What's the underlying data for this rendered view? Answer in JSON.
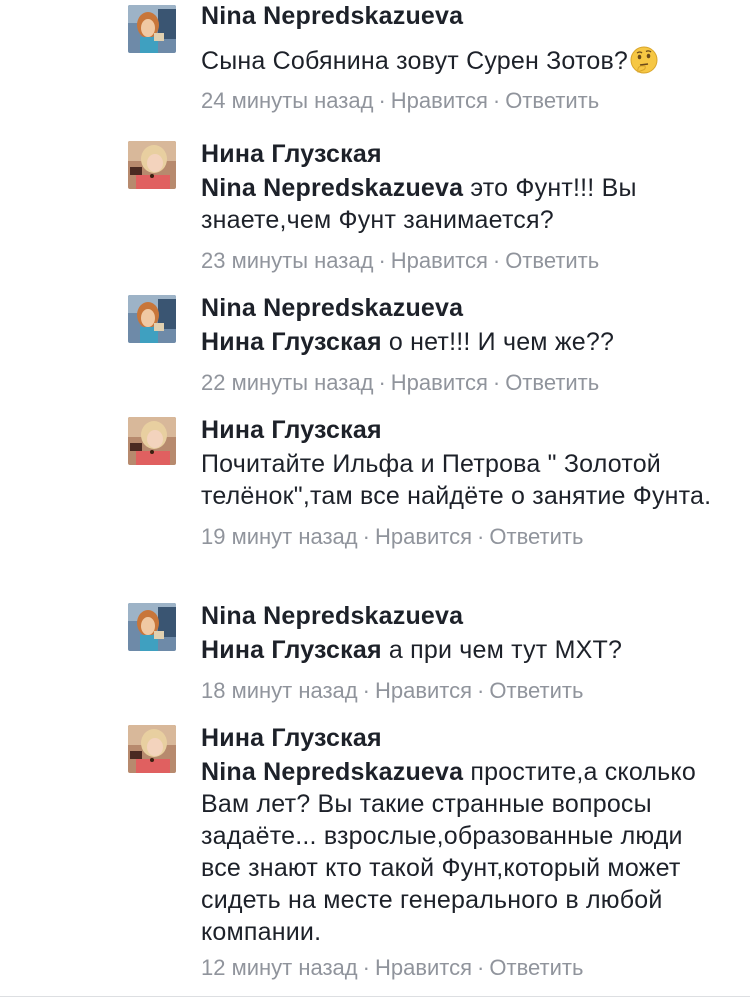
{
  "comments": [
    {
      "author": "Nina Nepredskazueva",
      "mention": "",
      "text": "Сына Собянина зовут Сурен Зотов?",
      "emoji": "thinking-face",
      "time": "24 минуты назад",
      "like": "Нравится",
      "reply": "Ответить",
      "avatar": "avatar-nina"
    },
    {
      "author": "Нина Глузская",
      "mention": "Nina Nepredskazueva",
      "text": " это Фунт!!! Вы знаете,чем Фунт занимается?",
      "time": "23 минуты назад",
      "like": "Нравится",
      "reply": "Ответить",
      "avatar": "avatar-glusskaya"
    },
    {
      "author": "Nina Nepredskazueva",
      "mention": "Нина Глузская",
      "text": " о нет!!! И чем же??",
      "time": "22 минуты назад",
      "like": "Нравится",
      "reply": "Ответить",
      "avatar": "avatar-nina"
    },
    {
      "author": "Нина Глузская",
      "mention": "",
      "text": "Почитайте Ильфа и Петрова \" Золотой телёнок\",там все найдёте о занятие Фунта.",
      "time": "19 минут назад",
      "like": "Нравится",
      "reply": "Ответить",
      "avatar": "avatar-glusskaya"
    },
    {
      "author": "Nina Nepredskazueva",
      "mention": "Нина Глузская",
      "text": " а при чем тут МХТ?",
      "time": "18 минут назад",
      "like": "Нравится",
      "reply": "Ответить",
      "avatar": "avatar-nina"
    },
    {
      "author": "Нина Глузская",
      "mention": "Nina Nepredskazueva",
      "text": " простите,а сколько Вам лет? Вы такие странные вопросы задаёте... взрослые,образованные люди все знают кто такой Фунт,который может сидеть на месте генерального в любой компании.",
      "time": "12 минут назад",
      "like": "Нравится",
      "reply": "Ответить",
      "avatar": "avatar-glusskaya"
    }
  ],
  "meta_separator": "·",
  "colors": {
    "text": "#1d2129",
    "meta": "#90949c",
    "divider": "#dddfe2"
  }
}
